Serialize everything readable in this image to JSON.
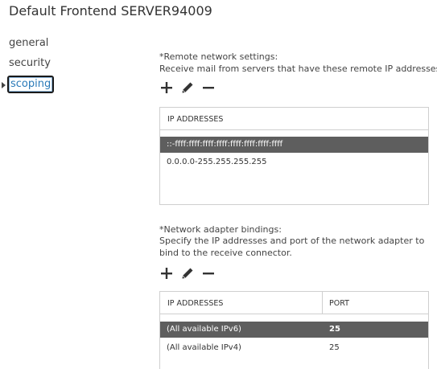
{
  "window": {
    "title": "Default Frontend SERVER94009"
  },
  "nav": {
    "items": [
      {
        "label": "general",
        "selected": false
      },
      {
        "label": "security",
        "selected": false
      },
      {
        "label": "scoping",
        "selected": true
      }
    ]
  },
  "remote": {
    "heading": "*Remote network settings:",
    "description": "Receive mail from servers that have these remote IP addresses.",
    "toolbar": {
      "add_icon": "plus-icon",
      "edit_icon": "pencil-icon",
      "remove_icon": "minus-icon"
    },
    "columns": [
      "IP ADDRESSES"
    ],
    "rows": [
      {
        "ip": "::-ffff:ffff:ffff:ffff:ffff:ffff:ffff:ffff",
        "selected": true
      },
      {
        "ip": "0.0.0.0-255.255.255.255",
        "selected": false
      }
    ]
  },
  "bindings": {
    "heading": "*Network adapter bindings:",
    "description_line1": "Specify the IP addresses and port of the network adapter to",
    "description_line2": "bind to the receive connector.",
    "toolbar": {
      "add_icon": "plus-icon",
      "edit_icon": "pencil-icon",
      "remove_icon": "minus-icon"
    },
    "columns": [
      "IP ADDRESSES",
      "PORT"
    ],
    "rows": [
      {
        "ip": "(All available IPv6)",
        "port": "25",
        "selected": true
      },
      {
        "ip": "(All available IPv4)",
        "port": "25",
        "selected": false
      }
    ]
  },
  "colors": {
    "selected_row": "#5e5e5e",
    "nav_selected_text": "#2a7ab8",
    "border": "#cfcfcf"
  }
}
